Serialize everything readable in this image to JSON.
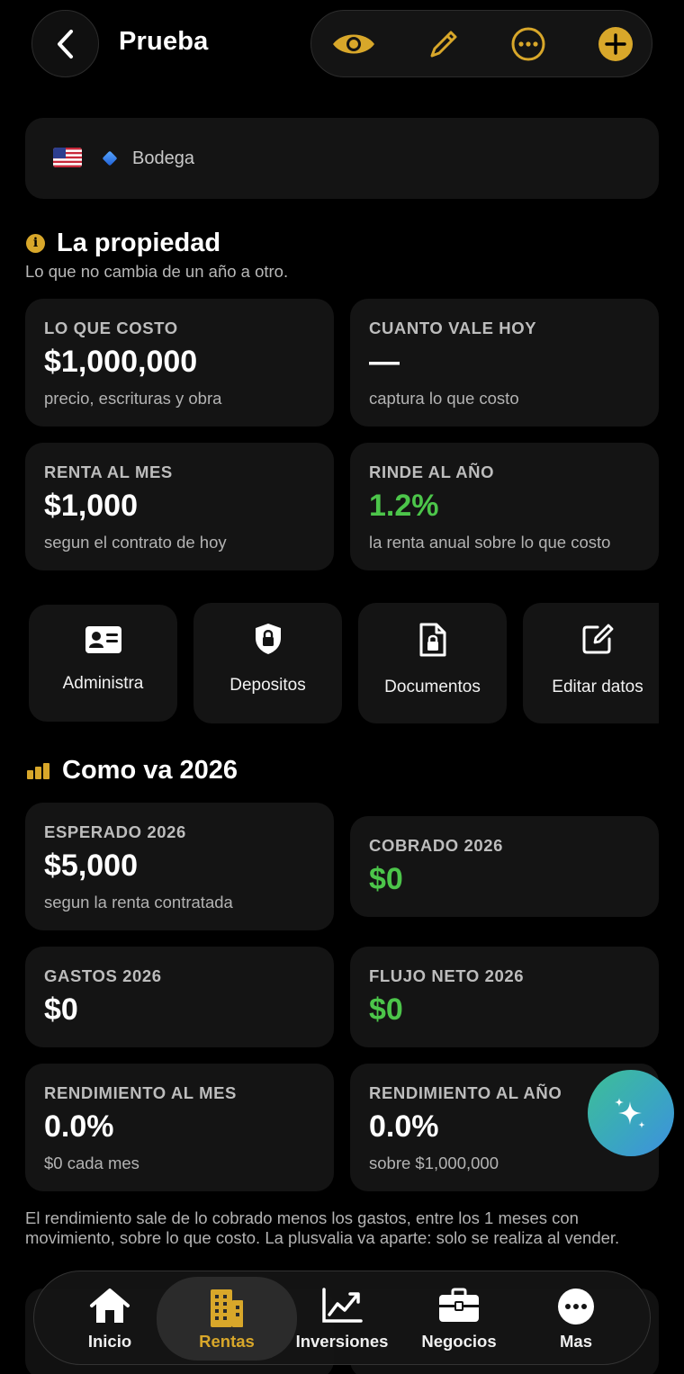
{
  "header": {
    "title": "Prueba"
  },
  "tag": {
    "text": "Bodega"
  },
  "property": {
    "title": "La propiedad",
    "subtitle": "Lo que no cambia de un año a otro.",
    "cards": [
      {
        "label": "LO QUE COSTO",
        "value": "$1,000,000",
        "sub": "precio, escrituras y obra"
      },
      {
        "label": "CUANTO VALE HOY",
        "value": "—",
        "sub": "captura lo que costo"
      },
      {
        "label": "RENTA AL MES",
        "value": "$1,000",
        "sub": "segun el contrato de hoy"
      },
      {
        "label": "RINDE AL AÑO",
        "value": "1.2%",
        "sub": "la renta anual sobre lo que costo"
      }
    ]
  },
  "actions": [
    {
      "label": "Administra",
      "icon": "id-card-icon"
    },
    {
      "label": "Depositos",
      "icon": "shield-lock-icon"
    },
    {
      "label": "Documentos",
      "icon": "document-lock-icon"
    },
    {
      "label": "Editar datos",
      "icon": "edit-square-icon"
    }
  ],
  "year": {
    "title": "Como va 2026",
    "cards": [
      {
        "label": "ESPERADO 2026",
        "value": "$5,000",
        "sub": "segun la renta contratada"
      },
      {
        "label": "COBRADO 2026",
        "value": "$0"
      },
      {
        "label": "GASTOS 2026",
        "value": "$0"
      },
      {
        "label": "FLUJO NETO 2026",
        "value": "$0"
      },
      {
        "label": "RENDIMIENTO AL MES",
        "value": "0.0%",
        "sub": "$0 cada mes"
      },
      {
        "label": "RENDIMIENTO AL AÑO",
        "value": "0.0%",
        "sub": "sobre $1,000,000"
      }
    ],
    "note": "El rendimiento sale de lo cobrado menos los gastos, entre los 1 meses con movimiento, sobre lo que costo. La plusvalia va aparte: solo se realiza al vender."
  },
  "tabs": [
    {
      "label": "Inicio",
      "icon": "home-icon"
    },
    {
      "label": "Rentas",
      "icon": "building-icon",
      "active": true
    },
    {
      "label": "Inversiones",
      "icon": "chart-line-icon"
    },
    {
      "label": "Negocios",
      "icon": "briefcase-icon"
    },
    {
      "label": "Mas",
      "icon": "more-icon"
    }
  ],
  "colors": {
    "accent": "#d8a72a",
    "positive": "#4cc54a",
    "card": "#141414"
  }
}
